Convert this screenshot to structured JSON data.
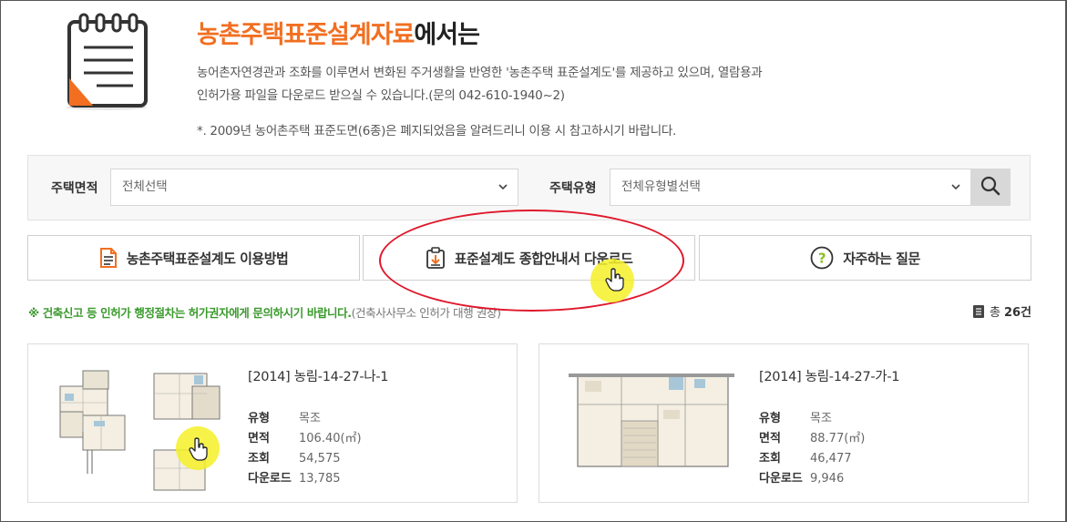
{
  "header": {
    "title_highlight": "농촌주택표준설계자료",
    "title_rest": "에서는",
    "desc_line1": "농어촌자연경관과 조화를 이루면서 변화된 주거생활을 반영한 '농촌주택 표준설계도'를 제공하고 있으며, 열람용과",
    "desc_line2": "인허가용 파일을 다운로드 받으실 수 있습니다.(문의 042-610-1940~2)",
    "note": "*. 2009년 농어촌주택 표준도면(6종)은 폐지되었음을 알려드리니 이용 시 참고하시기 바랍니다."
  },
  "filters": {
    "area_label": "주택면적",
    "area_value": "전체선택",
    "type_label": "주택유형",
    "type_value": "전체유형별선택"
  },
  "actions": {
    "usage": "농촌주택표준설계도 이용방법",
    "download_guide": "표준설계도 종합안내서 다운로드",
    "faq": "자주하는 질문"
  },
  "notice": {
    "main": "※ 건축신고 등 인허가 행정절차는 허가권자에게 문의하시기 바랍니다.",
    "sub": "(건축사사무소 인허가 대행 권장)"
  },
  "total": {
    "label": "총",
    "count": "26건"
  },
  "cards": [
    {
      "title": "[2014] 농림-14-27-나-1",
      "labels": [
        "유형",
        "면적",
        "조회",
        "다운로드"
      ],
      "values": [
        "목조",
        "106.40(㎡)",
        "54,575",
        "13,785"
      ]
    },
    {
      "title": "[2014] 농림-14-27-가-1",
      "labels": [
        "유형",
        "면적",
        "조회",
        "다운로드"
      ],
      "values": [
        "목조",
        "88.77(㎡)",
        "46,477",
        "9,946"
      ]
    }
  ],
  "colors": {
    "accent_orange": "#f26f21",
    "notice_green": "#3a9a2c",
    "annotation_red": "#e0182c",
    "cursor_highlight": "#f6f028"
  },
  "icons": {
    "header": "notebook-icon",
    "search": "search-icon",
    "usage": "document-icon",
    "download_guide": "clipboard-download-icon",
    "faq": "question-circle-icon",
    "total": "list-icon",
    "cursor": "hand-pointer-icon"
  }
}
